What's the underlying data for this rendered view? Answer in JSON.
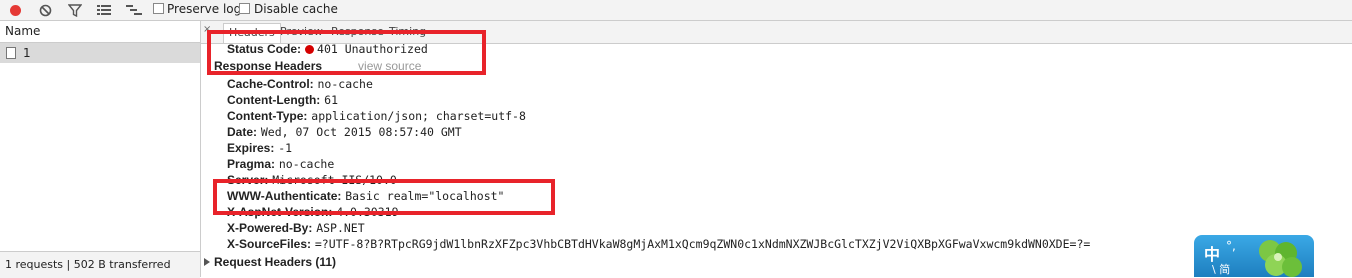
{
  "toolbar": {
    "preserve_log": "Preserve log",
    "disable_cache": "Disable cache"
  },
  "requests": {
    "column_name": "Name",
    "items": [
      {
        "name": "1"
      }
    ],
    "summary": "1 requests  |  502 B transferred"
  },
  "detail_tabs": [
    "Headers",
    "Preview",
    "Response",
    "Timing"
  ],
  "general": {
    "status_code_key": "Status Code:",
    "status_code_value": "401 Unauthorized"
  },
  "response_headers": {
    "title": "Response Headers",
    "view_source": "view source",
    "items": [
      {
        "key": "Cache-Control:",
        "value": "no-cache"
      },
      {
        "key": "Content-Length:",
        "value": "61"
      },
      {
        "key": "Content-Type:",
        "value": "application/json; charset=utf-8"
      },
      {
        "key": "Date:",
        "value": "Wed, 07 Oct 2015 08:57:40 GMT"
      },
      {
        "key": "Expires:",
        "value": "-1"
      },
      {
        "key": "Pragma:",
        "value": "no-cache"
      },
      {
        "key": "Server:",
        "value": "Microsoft-IIS/10.0"
      },
      {
        "key": "WWW-Authenticate:",
        "value": "Basic realm=\"localhost\""
      },
      {
        "key": "X-AspNet-Version:",
        "value": "4.0.30319"
      },
      {
        "key": "X-Powered-By:",
        "value": "ASP.NET"
      },
      {
        "key": "X-SourceFiles:",
        "value": "=?UTF-8?B?RTpcRG9jdW1lbnRzXFZpc3VhbCBTdHVkaW8gMjAxM1xQcm9qZWN0c1xNdmNXZWJBcGlcTXZjV2ViQXBpXGFwaVxwcm9kdWN0XDE=?="
      }
    ]
  },
  "request_headers": {
    "title": "Request Headers (11)"
  },
  "ime_widget": {
    "char": "中",
    "mark": "°,",
    "sub": "\\ 简"
  },
  "colors": {
    "highlight": "#e8232a",
    "record": "#e53935",
    "status_dot": "#d50000"
  }
}
